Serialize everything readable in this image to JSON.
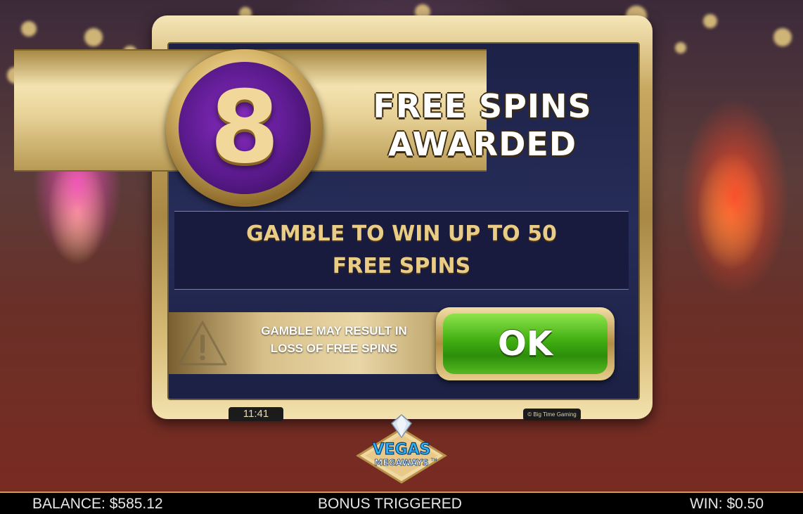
{
  "popup": {
    "badge_number": "8",
    "title_line1": "FREE SPINS",
    "title_line2": "AWARDED",
    "gamble_line1": "GAMBLE TO WIN UP TO 50",
    "gamble_line2": "FREE SPINS",
    "warning_line1": "GAMBLE MAY RESULT IN",
    "warning_line2": "LOSS OF FREE SPINS",
    "ok_label": "OK",
    "clock": "11:41",
    "copyright": "© Big Time Gaming"
  },
  "logo": {
    "line1": "VEGAS",
    "line2": "MEGAWAYS",
    "trademark": "TM",
    "icon": "diamond-icon"
  },
  "status_bar": {
    "balance": "BALANCE: $585.12",
    "message": "BONUS TRIGGERED",
    "win": "WIN: $0.50"
  },
  "colors": {
    "gold": "#d9bf7a",
    "panel_navy": "#1c2147",
    "badge_purple": "#5a1a8c",
    "ok_green": "#3fae12",
    "status_bar_border": "#c9a24a"
  }
}
